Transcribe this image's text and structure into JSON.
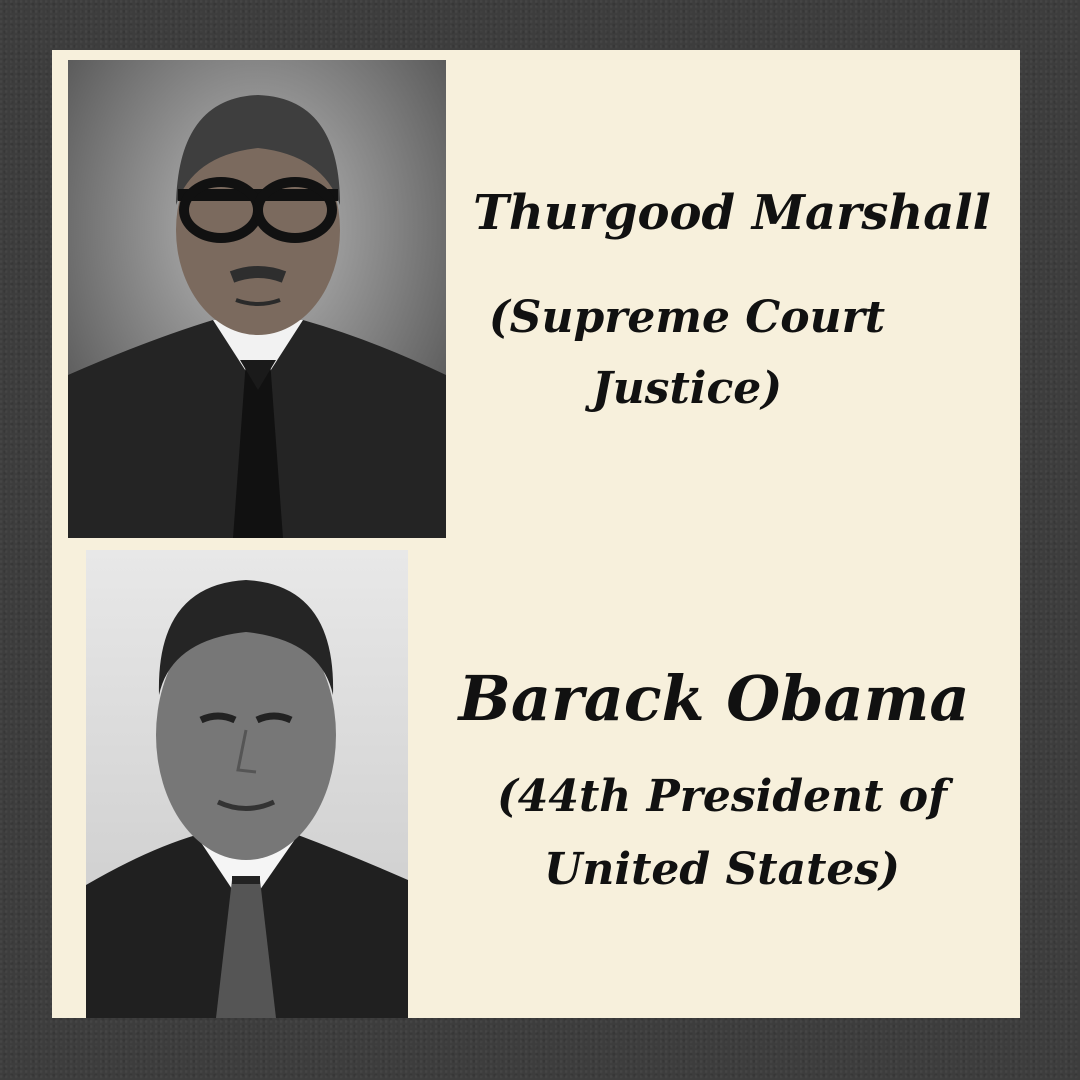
{
  "post": {
    "people": [
      {
        "name": "Thurgood Marshall",
        "role": "(Supreme Court Justice)",
        "portrait_icon": "portrait-man-glasses-suit-icon"
      },
      {
        "name": "Barack Obama",
        "role": "(44th President of United States)",
        "portrait_icon": "portrait-man-suit-icon"
      }
    ]
  },
  "colors": {
    "frame": "#3b3b3b",
    "card": "#f7f0dc",
    "text": "#111111"
  }
}
